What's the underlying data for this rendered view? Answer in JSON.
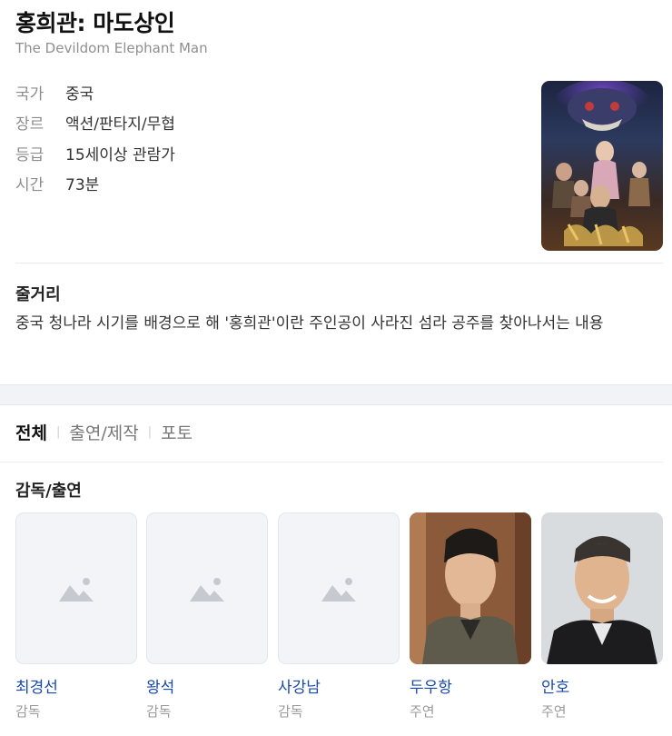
{
  "movie": {
    "title": "홍희관: 마도상인",
    "original_title": "The Devildom Elephant Man"
  },
  "info": [
    {
      "label": "국가",
      "value": "중국"
    },
    {
      "label": "장르",
      "value": "액션/판타지/무협"
    },
    {
      "label": "등급",
      "value": "15세이상 관람가"
    },
    {
      "label": "시간",
      "value": "73분"
    }
  ],
  "plot": {
    "heading": "줄거리",
    "text": "중국 청나라 시기를 배경으로 해 '홍희관'이란 주인공이 사라진 섬라 공주를 찾아나서는 내용"
  },
  "tabs": [
    {
      "label": "전체",
      "active": true
    },
    {
      "label": "출연/제작",
      "active": false
    },
    {
      "label": "포토",
      "active": false
    }
  ],
  "cast_section": {
    "heading": "감독/출연",
    "people": [
      {
        "name": "최경선",
        "role": "감독",
        "photo": "placeholder-image-icon"
      },
      {
        "name": "왕석",
        "role": "감독",
        "photo": "placeholder-image-icon"
      },
      {
        "name": "사강남",
        "role": "감독",
        "photo": "placeholder-image-icon"
      },
      {
        "name": "두우항",
        "role": "주연",
        "photo": "portrait"
      },
      {
        "name": "안호",
        "role": "주연",
        "photo": "portrait"
      }
    ]
  },
  "colors": {
    "link": "#1a4aa8",
    "label": "#8c8c8c",
    "divider": "#f2f3f7"
  }
}
